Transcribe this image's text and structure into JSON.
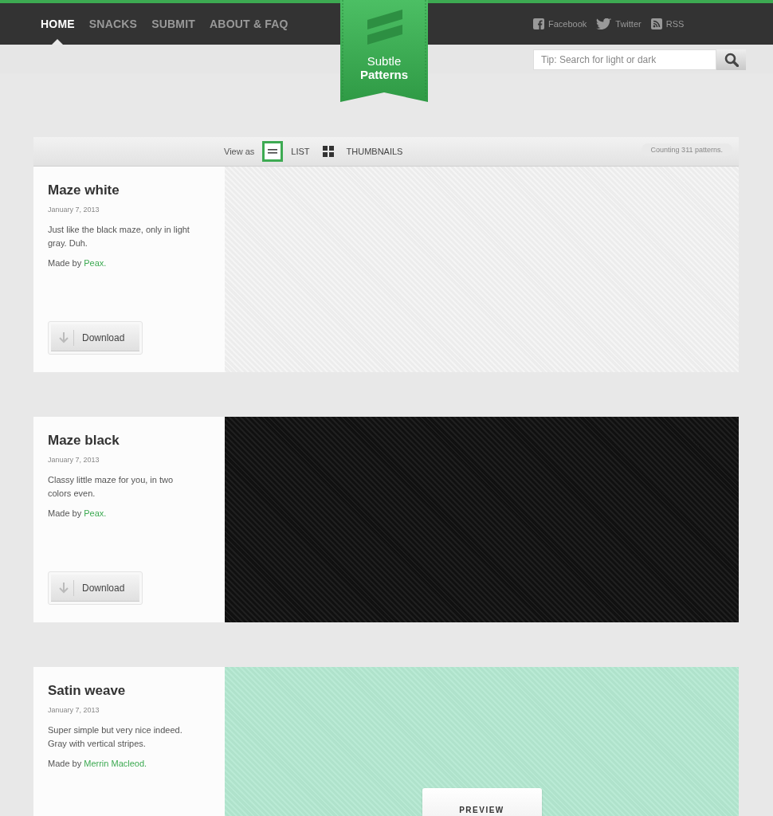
{
  "nav": {
    "items": [
      {
        "label": "HOME",
        "selected": true
      },
      {
        "label": "SNACKS",
        "selected": false
      },
      {
        "label": "SUBMIT",
        "selected": false
      },
      {
        "label": "ABOUT & FAQ",
        "selected": false
      }
    ]
  },
  "social": [
    {
      "label": "Facebook",
      "kind": "facebook"
    },
    {
      "label": "Twitter",
      "kind": "twitter"
    },
    {
      "label": "RSS",
      "kind": "rss"
    }
  ],
  "logo": {
    "line1": "Subtle",
    "line2": "Patterns"
  },
  "search": {
    "placeholder": "Tip: Search for light or dark"
  },
  "toolbar": {
    "view_label": "View as",
    "views": [
      {
        "label": "LIST",
        "kind": "list",
        "selected": true
      },
      {
        "label": "THUMBNAILS",
        "kind": "grid",
        "selected": false
      }
    ],
    "count": "Counting 311 patterns."
  },
  "patterns": [
    {
      "title": "Maze white",
      "date": "January 7, 2013",
      "description": "Just like the black maze, only in light gray. Duh.",
      "credit": "Made by",
      "author": "Peax.",
      "download": "Download",
      "color": "#f4f4f4"
    },
    {
      "title": "Maze black",
      "date": "January 7, 2013",
      "description": "Classy little maze for you, in two colors even.",
      "credit": "Made by",
      "author": "Peax.",
      "download": "Download",
      "color": "#111111"
    },
    {
      "title": "Satin weave",
      "date": "January 7, 2013",
      "description": "Super simple but very nice indeed. Gray with vertical stripes.",
      "credit": "Made by",
      "author": "Merrin Macleod.",
      "color": "#b5e9d2",
      "preview_button": "PREVIEW"
    }
  ]
}
